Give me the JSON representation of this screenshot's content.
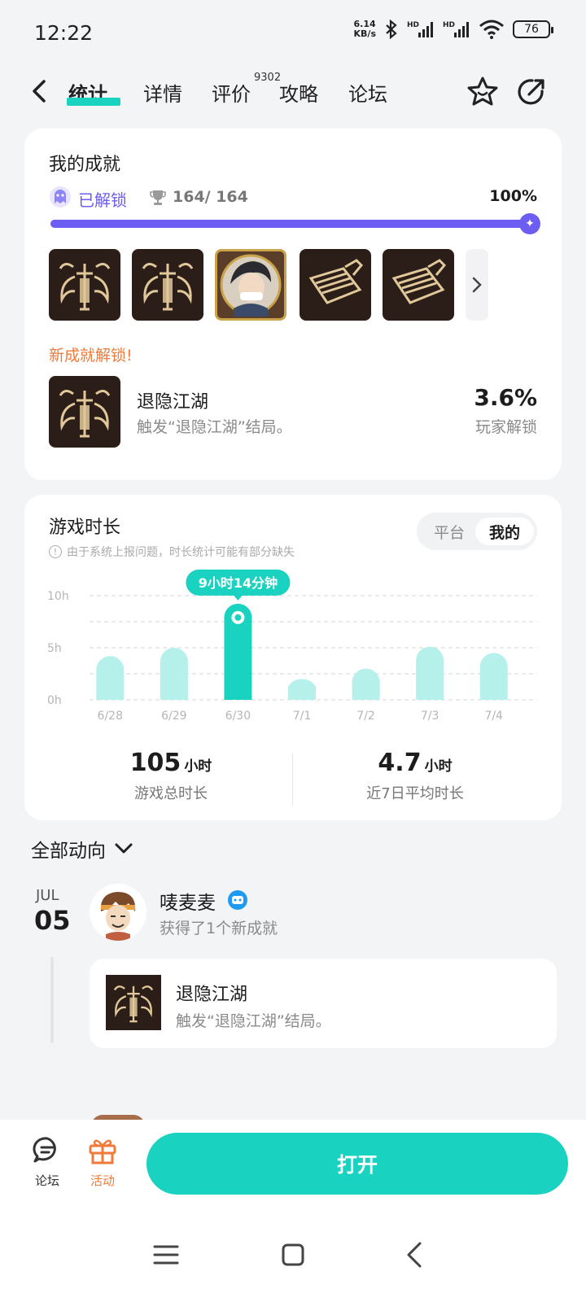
{
  "status_bar": {
    "time": "12:22",
    "net_speed_value": "6.14",
    "net_speed_unit": "KB/s",
    "signal_tag_1": "HD",
    "signal_tag_2": "HD",
    "battery": "76"
  },
  "nav": {
    "tabs": [
      {
        "label": "统计",
        "active": true
      },
      {
        "label": "详情"
      },
      {
        "label": "评价"
      },
      {
        "label": "攻略"
      },
      {
        "label": "论坛"
      }
    ],
    "review_count": "9302"
  },
  "achievements": {
    "title": "我的成就",
    "status": "已解锁",
    "count": "164/ 164",
    "percent": "100%",
    "progress": 1.0,
    "new_label": "新成就解锁!",
    "new": {
      "name": "退隐江湖",
      "desc": "触发“退隐江湖”结局。",
      "rate": "3.6%",
      "rate_label": "玩家解锁"
    }
  },
  "playtime": {
    "title": "游戏时长",
    "note": "由于系统上报问题，时长统计可能有部分缺失",
    "segment": {
      "options": [
        "平台",
        "我的"
      ],
      "selected": "我的"
    },
    "tooltip": "9小时14分钟",
    "total_value": "105",
    "total_unit": "小时",
    "total_label": "游戏总时长",
    "avg_value": "4.7",
    "avg_unit": "小时",
    "avg_label": "近7日平均时长"
  },
  "chart_data": {
    "type": "bar",
    "categories": [
      "6/28",
      "6/29",
      "6/30",
      "7/1",
      "7/2",
      "7/3",
      "7/4"
    ],
    "values": [
      4.2,
      5.0,
      9.23,
      2.0,
      3.0,
      5.1,
      4.5
    ],
    "ylim": [
      0,
      10
    ],
    "yticks": [
      "10h",
      "5h",
      "0h"
    ],
    "highlight_index": 2,
    "grid": true,
    "colors": {
      "bar": "#b5f0ea",
      "highlight": "#19d3c0"
    }
  },
  "activity": {
    "filter_label": "全部动向",
    "month": "JUL",
    "day": "05",
    "user": "唛麦麦",
    "action": "获得了1个新成就",
    "item": {
      "name": "退隐江湖",
      "desc": "触发“退隐江湖”结局。"
    }
  },
  "bottom_bar": {
    "forum_label": "论坛",
    "event_label": "活动",
    "open_label": "打开"
  },
  "colors": {
    "accent": "#19d3c0",
    "purple": "#6e5df2",
    "orange": "#f07a3a"
  }
}
